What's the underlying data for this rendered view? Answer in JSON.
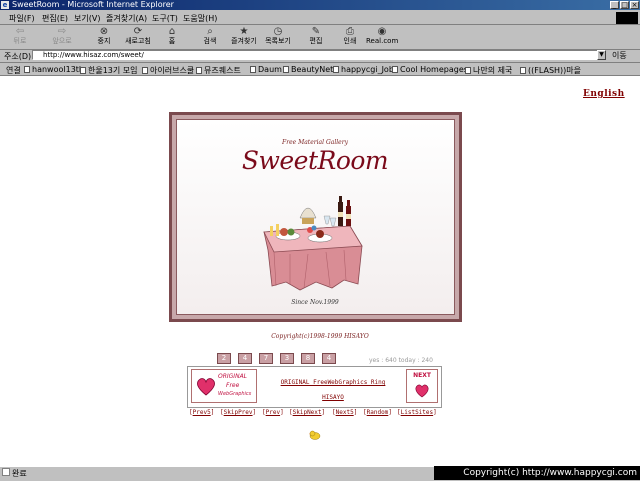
{
  "window": {
    "title": "SweetRoom - Microsoft Internet Explorer",
    "app_icon": "ie-icon"
  },
  "menu": [
    "파일(F)",
    "편집(E)",
    "보기(V)",
    "즐겨찾기(A)",
    "도구(T)",
    "도움말(H)"
  ],
  "toolbar": {
    "back": "뒤로",
    "forward": "앞으로",
    "stop": "중지",
    "refresh": "새로고침",
    "home": "홈",
    "search": "검색",
    "favorites": "즐겨찾기",
    "history": "목록보기",
    "edit": "편집",
    "print": "인쇄",
    "realcom": "Real.com"
  },
  "address": {
    "label": "주소(D)",
    "value": "http://www.hisaz.com/sweet/",
    "go": "이동"
  },
  "links": {
    "label": "연결",
    "items": [
      "hanwool13th",
      "한울13기 모임",
      "아이러브스쿨",
      "뮤즈퀘스트",
      "Daum",
      "BeautyNet",
      "happycgi_Job",
      "Cool Homepages",
      "나만의 제국",
      "((FLASH))마을"
    ]
  },
  "page": {
    "english": "English",
    "tagline": "Free Material Gallery",
    "title": "SweetRoom",
    "since": "Since Nov.1999",
    "copyright": "Copyright(c)1998-1999 HISAYO",
    "counter_digits": [
      "2",
      "4",
      "7",
      "3",
      "8",
      "4"
    ],
    "counter_text": "yes : 640  today : 240"
  },
  "ring": {
    "logo_line1": "ORIGINAL",
    "logo_line2": "Free",
    "logo_line3": "WebGraphics",
    "title": "ORIGINAL FreeWebGraphics Ring",
    "owner": "HISAYO",
    "next": "NEXT",
    "nav": [
      "Prev5",
      "SkipPrev",
      "Prev",
      "SkipNext",
      "Next5",
      "Random",
      "ListSites"
    ]
  },
  "status": {
    "text": "완료"
  },
  "watermark": "Copyright(c) http://www.happycgi.com"
}
